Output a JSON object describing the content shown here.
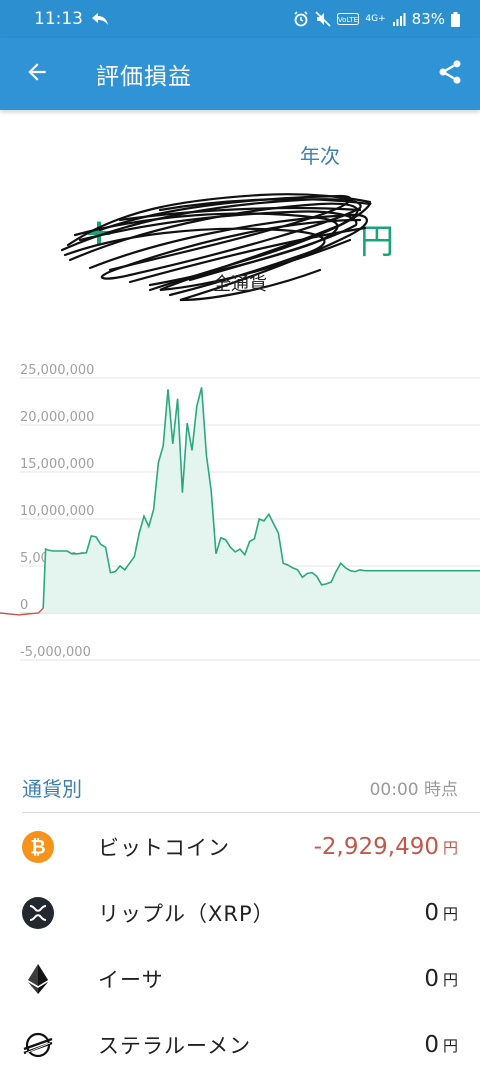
{
  "status_bar": {
    "time": "11:13",
    "battery": "83%",
    "network": "4G+",
    "volte": "VoLTE"
  },
  "app_bar": {
    "title": "評価損益",
    "back_icon": "arrow-left-icon",
    "share_icon": "share-icon"
  },
  "summary": {
    "period": "年次",
    "amount_sign": "+",
    "amount_value": "",
    "amount_unit": "円",
    "amount_redacted": true,
    "scope": "全通貨",
    "colors": {
      "positive": "#1aa47a",
      "negative": "#c4574c",
      "accent": "#3c7fb0"
    }
  },
  "chart_data": {
    "type": "area",
    "title": "",
    "xlabel": "",
    "ylabel": "",
    "y_ticks": [
      "25,000,000",
      "20,000,000",
      "15,000,000",
      "10,000,000",
      "5,000,000",
      "0",
      "-5,000,000"
    ],
    "ylim": [
      -5000000,
      25000000
    ],
    "grid": true,
    "fill_color": "#e4f5ef",
    "line_color": "#2aa97e",
    "pre_line_color": "#c4574c",
    "x": [
      0,
      4,
      8,
      9,
      9.5,
      10,
      11,
      14,
      15,
      16,
      18,
      19,
      20,
      21,
      22,
      23,
      24,
      25,
      26,
      27,
      28,
      29,
      30,
      31,
      32,
      33,
      34,
      35,
      36,
      37,
      38,
      39,
      40,
      41,
      42,
      43,
      44,
      45,
      46,
      47,
      48,
      49,
      50,
      51,
      52,
      53,
      54,
      55,
      56,
      57,
      58,
      59,
      60,
      61,
      62,
      63,
      64,
      65,
      66,
      67,
      68,
      69,
      70,
      71,
      72,
      73,
      74,
      75,
      76,
      77,
      78,
      79,
      80,
      81,
      82,
      83,
      84,
      85,
      86,
      87,
      88,
      89,
      90,
      91,
      92,
      93,
      94,
      95,
      96,
      97,
      98,
      99,
      100
    ],
    "y": [
      0,
      -200000,
      0,
      500000,
      6800000,
      6700000,
      6600000,
      6600000,
      6300000,
      6300000,
      6400000,
      8200000,
      8100000,
      7300000,
      7000000,
      4300000,
      4400000,
      5000000,
      4600000,
      5300000,
      6000000,
      8500000,
      10300000,
      9200000,
      11000000,
      16000000,
      17800000,
      23800000,
      18000000,
      22800000,
      12800000,
      20200000,
      17300000,
      22000000,
      24000000,
      16800000,
      13000000,
      6300000,
      8000000,
      7800000,
      7000000,
      6500000,
      6800000,
      6200000,
      7600000,
      7900000,
      10000000,
      9800000,
      10500000,
      9500000,
      8500000,
      5300000,
      5100000,
      4800000,
      4600000,
      3800000,
      4200000,
      4300000,
      3900000,
      3000000,
      3100000,
      3300000,
      4400000,
      5300000,
      4800000,
      4500000,
      4400000,
      4600000,
      4500000,
      4500000,
      4500000,
      4500000,
      4500000,
      4500000,
      4500000,
      4500000,
      4500000,
      4500000,
      4500000,
      4500000,
      4500000,
      4500000,
      4500000,
      4500000,
      4500000,
      4500000,
      4500000,
      4500000,
      4500000,
      4500000,
      4500000,
      4500000,
      4500000
    ]
  },
  "section": {
    "label": "通貨別",
    "time": "00:00 時点"
  },
  "coins": [
    {
      "name": "ビットコイン",
      "value": "-2,929,490",
      "unit": "円",
      "negative": true,
      "icon": "bitcoin-icon",
      "color": "#f7931a"
    },
    {
      "name": "リップル（XRP）",
      "value": "0",
      "unit": "円",
      "negative": false,
      "icon": "xrp-icon",
      "color": "#23292f"
    },
    {
      "name": "イーサ",
      "value": "0",
      "unit": "円",
      "negative": false,
      "icon": "ethereum-icon",
      "color": "#3c3c3d"
    },
    {
      "name": "ステラルーメン",
      "value": "0",
      "unit": "円",
      "negative": false,
      "icon": "stellar-icon",
      "color": "#111111"
    }
  ]
}
